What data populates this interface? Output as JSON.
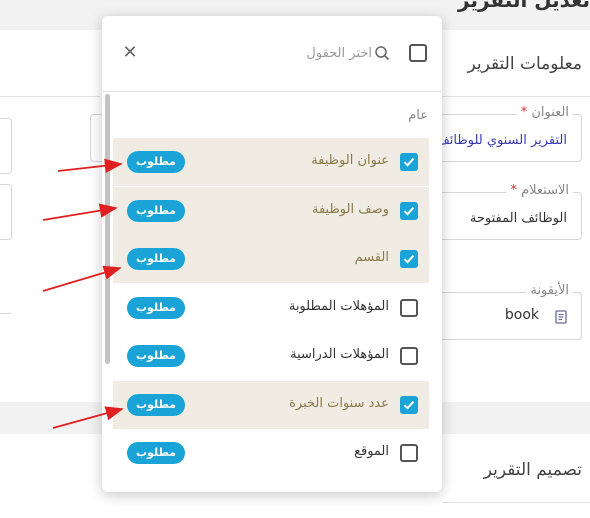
{
  "page": {
    "title": "تعديل التقرير",
    "info_section_title": "معلومات التقرير",
    "design_section_title": "تصميم التقرير"
  },
  "form": {
    "title_field": {
      "label": "العنوان",
      "value": "التقرير السنوي للوظائف"
    },
    "query_field": {
      "label": "الاستعلام",
      "value": "الوظائف المفتوحة"
    },
    "icon_field": {
      "label": "الأيقونة",
      "value": "book",
      "icon": "book-icon"
    },
    "required_marker": "*"
  },
  "popup": {
    "search_placeholder": "اختر الحقول",
    "select_all_checked": false,
    "group_label": "عام",
    "badge_label": "مطلوب",
    "fields": [
      {
        "label": "عنوان الوظيفة",
        "checked": true,
        "highlighted": true,
        "badge": "مطلوب"
      },
      {
        "label": "وصف الوظيفة",
        "checked": true,
        "highlighted": true,
        "badge": "مطلوب"
      },
      {
        "label": "القسم",
        "checked": true,
        "highlighted": true,
        "badge": "مطلوب"
      },
      {
        "label": "المؤهلات المطلوبة",
        "checked": false,
        "highlighted": false,
        "badge": "مطلوب"
      },
      {
        "label": "المؤهلات الدراسية",
        "checked": false,
        "highlighted": false,
        "badge": "مطلوب"
      },
      {
        "label": "عدد سنوات الخبرة",
        "checked": true,
        "highlighted": true,
        "badge": "مطلوب"
      },
      {
        "label": "الموقع",
        "checked": false,
        "highlighted": false,
        "badge": "مطلوب"
      }
    ]
  },
  "colors": {
    "accent": "#1aa3d6",
    "highlight_row": "#f0ece3",
    "annotation_arrow": "#e02020",
    "required": "#d03030"
  }
}
